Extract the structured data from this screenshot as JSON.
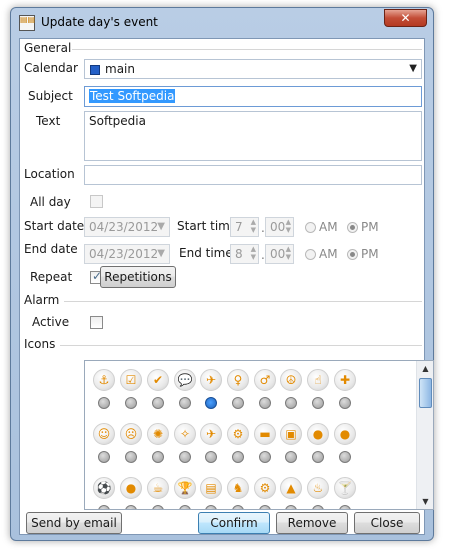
{
  "window": {
    "title": "Update day's event",
    "close_glyph": "✕"
  },
  "general": {
    "section_label": "General",
    "calendar_label": "Calendar",
    "calendar_value": "main",
    "calendar_color": "#2460c8",
    "subject_label": "Subject",
    "subject_value": "Test Softpedia",
    "text_label": "Text",
    "text_value": "Softpedia",
    "location_label": "Location",
    "location_value": "",
    "allday_label": "All day",
    "start_date_label": "Start date",
    "start_date_value": "04/23/2012",
    "start_time_label": "Start time",
    "start_hour": "7",
    "start_min": "00",
    "end_date_label": "End date",
    "end_date_value": "04/23/2012",
    "end_time_label": "End time",
    "end_hour": "8",
    "end_min": "00",
    "am_label": "AM",
    "pm_label": "PM",
    "repeat_label": "Repeat",
    "repetitions_button": "Repetitions",
    "time_separator": "."
  },
  "alarm": {
    "section_label": "Alarm",
    "active_label": "Active"
  },
  "icons": {
    "section_label": "Icons",
    "selected_index": 4,
    "rows": [
      [
        "anchor-icon",
        "checklist-icon",
        "check-icon",
        "chat-icon",
        "airplane-icon",
        "female-icon",
        "male-icon",
        "peace-icon",
        "hand-icon",
        "puzzle-icon"
      ],
      [
        "smile-icon",
        "sad-icon",
        "spiral-icon",
        "sparkle-icon",
        "plane-icon",
        "bicycle-icon",
        "car-icon",
        "bus-icon",
        "basketball-icon",
        "football-icon"
      ],
      [
        "soccer-icon",
        "ball-icon",
        "coffee-icon",
        "trophy-icon",
        "clapper-icon",
        "runner-icon",
        "cyclist-icon",
        "ship-icon",
        "cake-icon",
        "cocktail-icon"
      ]
    ],
    "glyphs": [
      [
        "⚓",
        "☑",
        "✔",
        "💬",
        "✈",
        "♀",
        "♂",
        "☮",
        "☝",
        "✚"
      ],
      [
        "☺",
        "☹",
        "✺",
        "✧",
        "✈",
        "⚙",
        "▬",
        "▣",
        "●",
        "●"
      ],
      [
        "⚽",
        "●",
        "☕",
        "🏆",
        "▤",
        "♞",
        "⚙",
        "▲",
        "♨",
        "🍸"
      ]
    ]
  },
  "buttons": {
    "send_email": "Send by email",
    "confirm": "Confirm",
    "remove": "Remove",
    "close": "Close"
  }
}
